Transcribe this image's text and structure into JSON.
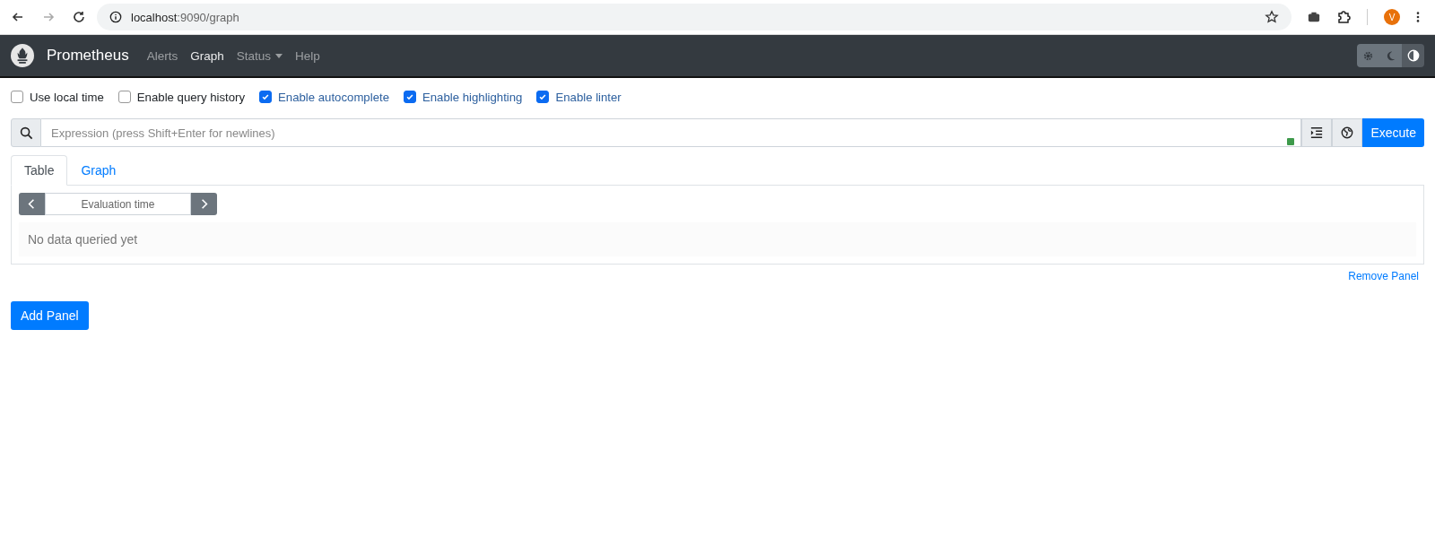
{
  "browser": {
    "back_disabled": false,
    "forward_disabled": true,
    "url_host": "localhost",
    "url_rest": ":9090/graph",
    "avatar": "V"
  },
  "navbar": {
    "brand": "Prometheus",
    "items": [
      {
        "label": "Alerts",
        "selected": false,
        "dropdown": false
      },
      {
        "label": "Graph",
        "selected": true,
        "dropdown": false
      },
      {
        "label": "Status",
        "selected": false,
        "dropdown": true
      },
      {
        "label": "Help",
        "selected": false,
        "dropdown": false
      }
    ],
    "theme_buttons": [
      {
        "kind": "light",
        "selected": false
      },
      {
        "kind": "dark",
        "selected": false
      },
      {
        "kind": "auto",
        "selected": true
      }
    ]
  },
  "options": [
    {
      "label": "Use local time",
      "checked": false
    },
    {
      "label": "Enable query history",
      "checked": false
    },
    {
      "label": "Enable autocomplete",
      "checked": true
    },
    {
      "label": "Enable highlighting",
      "checked": true
    },
    {
      "label": "Enable linter",
      "checked": true
    }
  ],
  "expression": {
    "placeholder": "Expression (press Shift+Enter for newlines)",
    "execute": "Execute"
  },
  "panel": {
    "tabs": [
      {
        "label": "Table",
        "selected": true
      },
      {
        "label": "Graph",
        "selected": false
      }
    ],
    "evaluation_time": {
      "placeholder": "Evaluation time"
    },
    "message": "No data queried yet",
    "remove": "Remove Panel"
  },
  "add_panel": "Add Panel"
}
